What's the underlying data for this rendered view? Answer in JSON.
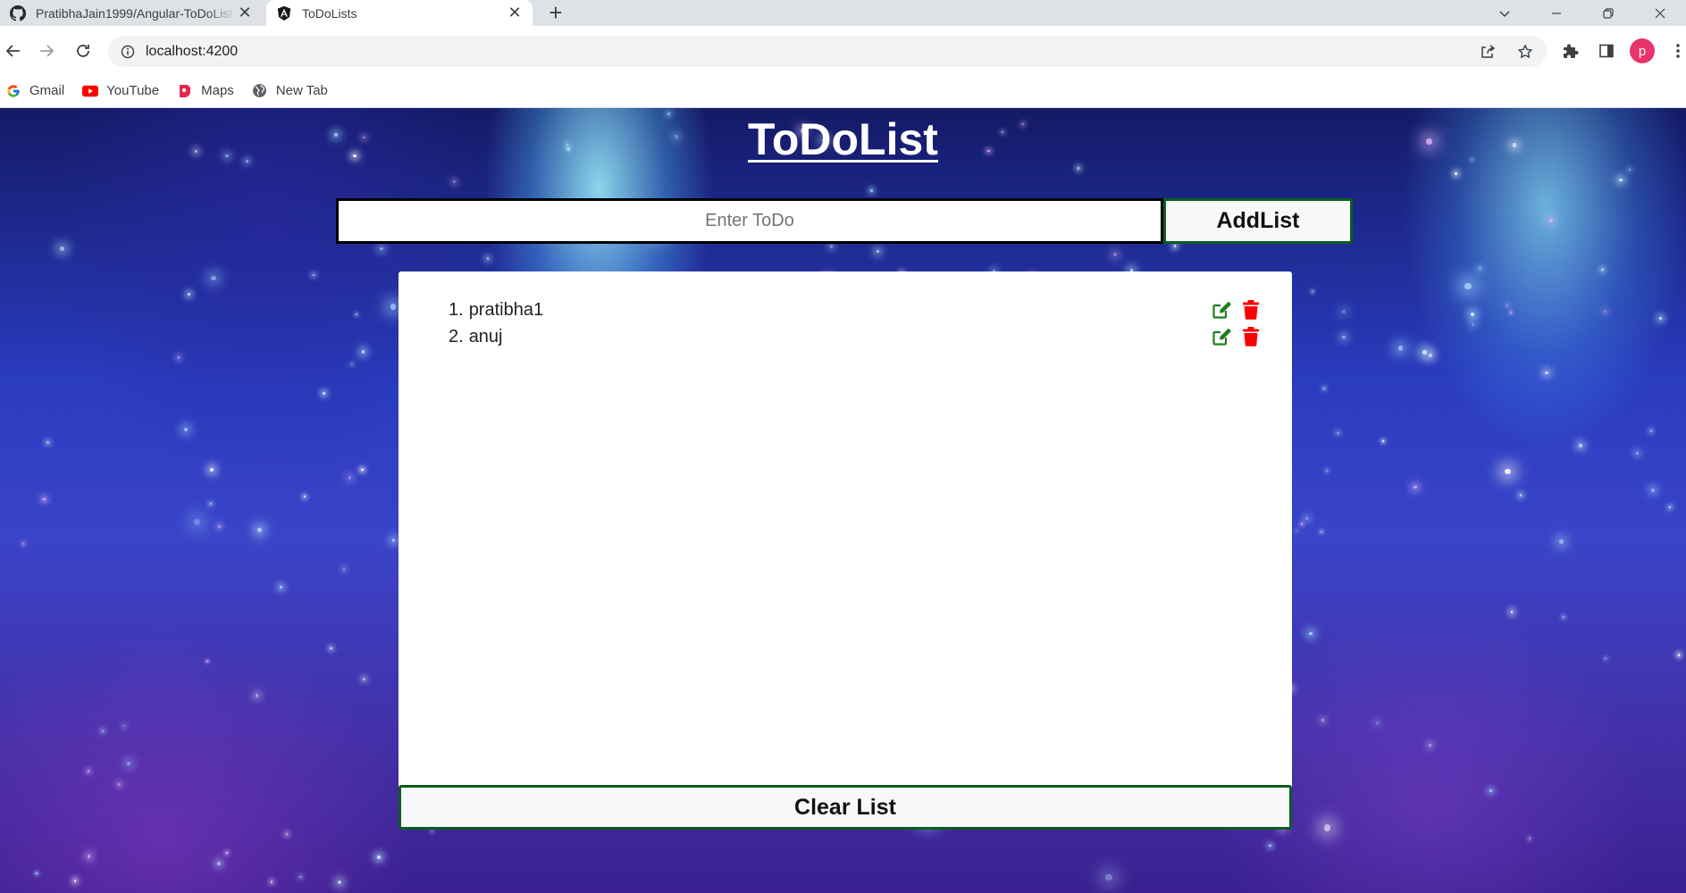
{
  "browser": {
    "tabs": [
      {
        "title": "PratibhaJain1999/Angular-ToDoList",
        "icon": "github-icon",
        "active": false
      },
      {
        "title": "ToDoLists",
        "icon": "angular-icon",
        "active": true
      }
    ],
    "url": "localhost:4200",
    "profile_initial": "p",
    "bookmarks": [
      {
        "label": "Gmail",
        "icon": "google-icon"
      },
      {
        "label": "YouTube",
        "icon": "youtube-icon"
      },
      {
        "label": "Maps",
        "icon": "maps-icon"
      },
      {
        "label": "New Tab",
        "icon": "globe-icon"
      }
    ]
  },
  "app": {
    "title": "ToDoList",
    "input_placeholder": "Enter ToDo",
    "input_value": "",
    "add_button_label": "AddList",
    "clear_button_label": "Clear List",
    "items": [
      {
        "number": "1.",
        "text": "pratibha1"
      },
      {
        "number": "2.",
        "text": "anuj"
      }
    ]
  },
  "colors": {
    "edit_icon": "#1e7e1e",
    "delete_icon": "#ff0000",
    "button_border": "#0b5e1d",
    "avatar": "#e8336d"
  }
}
